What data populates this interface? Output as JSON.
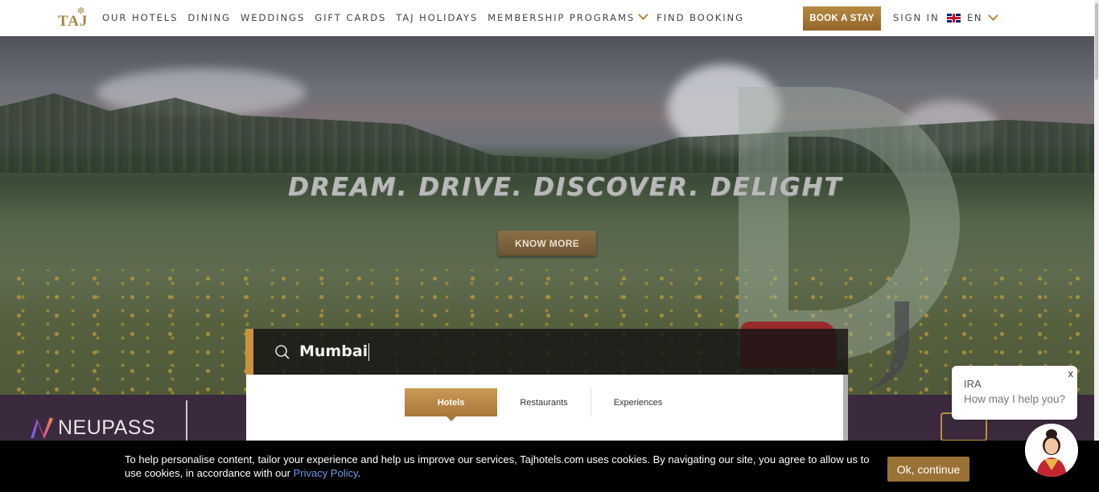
{
  "brand": {
    "logo_text": "TAJ"
  },
  "nav": {
    "items": [
      "OUR HOTELS",
      "DINING",
      "WEDDINGS",
      "GIFT CARDS",
      "TAJ HOLIDAYS",
      "MEMBERSHIP PROGRAMS",
      "FIND BOOKING"
    ],
    "book_label": "BOOK A STAY",
    "signin_label": "SIGN IN",
    "language": "EN"
  },
  "hero": {
    "tagline": "DREAM. DRIVE. DISCOVER. DELIGHT",
    "cta_label": "KNOW MORE"
  },
  "search": {
    "value": "Mumbai",
    "tabs": [
      "Hotels",
      "Restaurants",
      "Experiences"
    ],
    "active_tab": "Hotels"
  },
  "band": {
    "logo_text": "NEUPASS"
  },
  "cookie": {
    "text": "To help personalise content, tailor your experience and help us improve our services, Tajhotels.com uses cookies. By navigating our site, you agree to allow us to use cookies, in accordance with our ",
    "link_label": "Privacy Policy",
    "suffix": ".",
    "button_label": "Ok, continue"
  },
  "chat": {
    "name": "IRA",
    "message": "How may I help you?",
    "close_label": "x"
  },
  "colors": {
    "accent": "#b68a42",
    "band": "#3b2a3d",
    "cookie_bg": "#000000"
  }
}
